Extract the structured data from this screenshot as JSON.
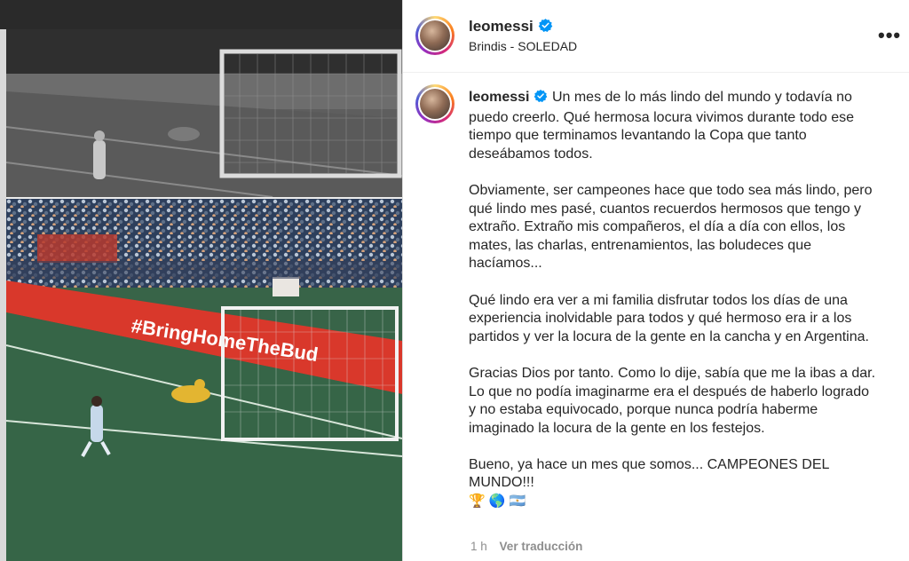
{
  "post": {
    "username": "leomessi",
    "location": "Brindis - SOLEDAD",
    "more_label": "•••",
    "caption_paragraphs": [
      "Un mes de lo más lindo del mundo y todavía no puedo creerlo. Qué hermosa locura vivimos durante todo ese tiempo que terminamos levantando la Copa que tanto deseábamos todos.",
      "Obviamente, ser campeones hace que todo sea más lindo, pero qué lindo mes pasé, cuantos recuerdos hermosos que tengo y extraño. Extraño mis compañeros, el día a día con ellos, los mates, las charlas, entrenamientos, las boludeces que hacíamos...",
      "Qué lindo era ver a mi familia disfrutar todos los días de una experiencia inolvidable para todos y qué hermoso era ir a los partidos y ver la locura de la gente en la cancha y en Argentina.",
      "Gracias Dios por tanto. Como lo dije, sabía que me la ibas a dar. Lo que no podía imaginarme era el después de haberlo logrado y no estaba equivocado, porque nunca podría haberme imaginado la locura de la gente en los festejos.",
      "Bueno, ya hace un mes que somos... CAMPEONES DEL MUNDO!!!"
    ],
    "caption_emojis": "🏆 🌎 🇦🇷",
    "time_ago": "1 h",
    "translate_label": "Ver traducción"
  },
  "image": {
    "banner_text": "#BringHomeTheBud"
  },
  "colors": {
    "verified": "#0095f6",
    "ad_board": "#d9382b",
    "meta_gray": "#8e8e8e",
    "text": "#262626"
  },
  "icons": [
    "verified-icon",
    "more-options-icon",
    "trophy-emoji",
    "globe-emoji",
    "argentina-flag-emoji"
  ]
}
